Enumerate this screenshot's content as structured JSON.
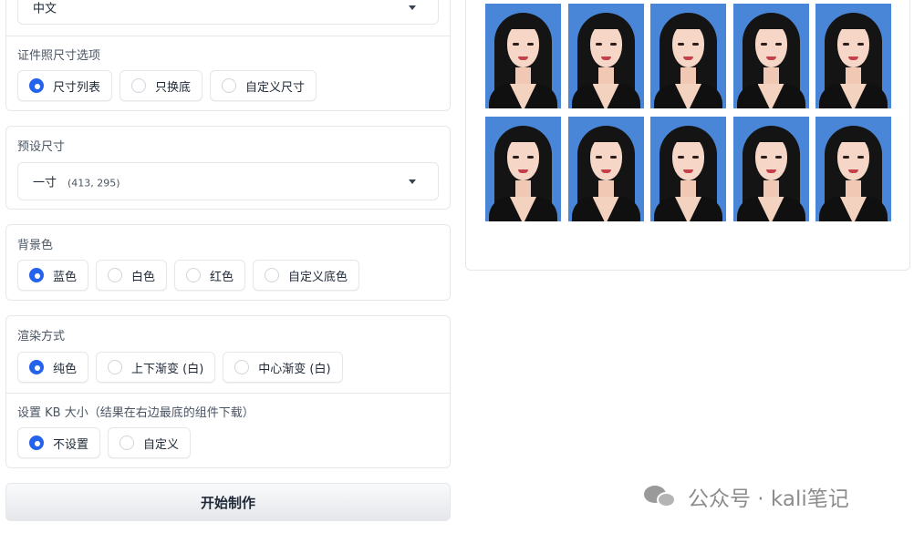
{
  "language_select": {
    "value": "中文"
  },
  "size_option": {
    "label": "证件照尺寸选项",
    "options": [
      "尺寸列表",
      "只换底",
      "自定义尺寸"
    ],
    "selected": "尺寸列表"
  },
  "preset_size": {
    "label": "预设尺寸",
    "value": "一寸",
    "dims": "(413, 295)"
  },
  "background": {
    "label": "背景色",
    "options": [
      "蓝色",
      "白色",
      "红色",
      "自定义底色"
    ],
    "selected": "蓝色",
    "color": "#4a86d8"
  },
  "render_mode": {
    "label": "渲染方式",
    "options": [
      "纯色",
      "上下渐变 (白)",
      "中心渐变 (白)"
    ],
    "selected": "纯色"
  },
  "kb_size": {
    "label": "设置 KB 大小（结果在右边最底的组件下载）",
    "options": [
      "不设置",
      "自定义"
    ],
    "selected": "不设置"
  },
  "start_button": {
    "label": "开始制作"
  },
  "gallery": {
    "photo_count": 10,
    "columns": 5
  },
  "watermark": {
    "text": "公众号 · kali笔记"
  },
  "colors": {
    "accent": "#2563eb",
    "border": "#e5e7eb"
  }
}
